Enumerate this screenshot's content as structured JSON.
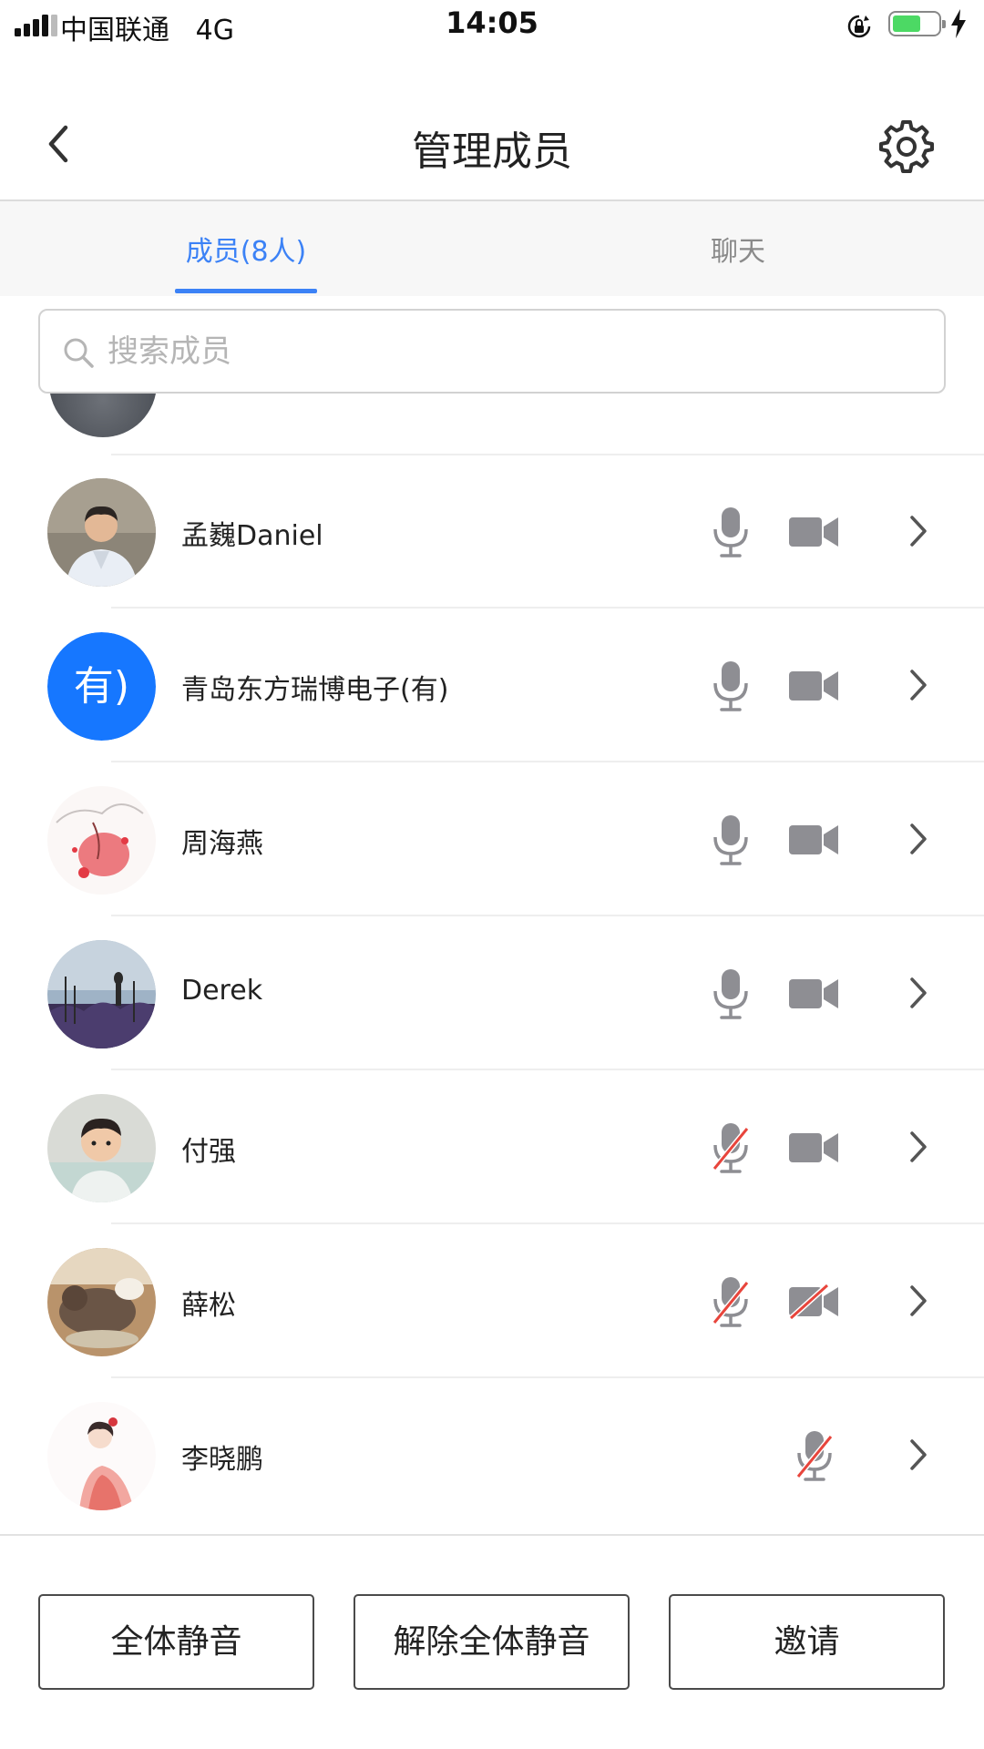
{
  "status_bar": {
    "carrier": "中国联通",
    "network": "4G",
    "time": "14:05"
  },
  "nav": {
    "title": "管理成员"
  },
  "tabs": [
    {
      "label": "成员(8人)",
      "active": true
    },
    {
      "label": "聊天",
      "active": false
    }
  ],
  "search": {
    "placeholder": "搜索成员",
    "value": ""
  },
  "members": [
    {
      "name": "孟巍Daniel",
      "mic_muted": false,
      "camera": "on"
    },
    {
      "name": "青岛东方瑞博电子(有)",
      "avatar_text": "有)",
      "mic_muted": false,
      "camera": "on"
    },
    {
      "name": "周海燕",
      "mic_muted": false,
      "camera": "on"
    },
    {
      "name": "Derek",
      "mic_muted": false,
      "camera": "on"
    },
    {
      "name": "付强",
      "mic_muted": true,
      "camera": "on"
    },
    {
      "name": "薛松",
      "mic_muted": true,
      "camera": "off"
    },
    {
      "name": "李晓鹏",
      "mic_muted": true,
      "camera": "none"
    }
  ],
  "actions": {
    "mute_all": "全体静音",
    "unmute_all": "解除全体静音",
    "invite": "邀请"
  },
  "colors": {
    "accent": "#3c82f6",
    "avatar_blue": "#1677ff",
    "icon_gray": "#8e8e93",
    "muted_slash": "#e8453c",
    "battery_green": "#4cd964"
  }
}
